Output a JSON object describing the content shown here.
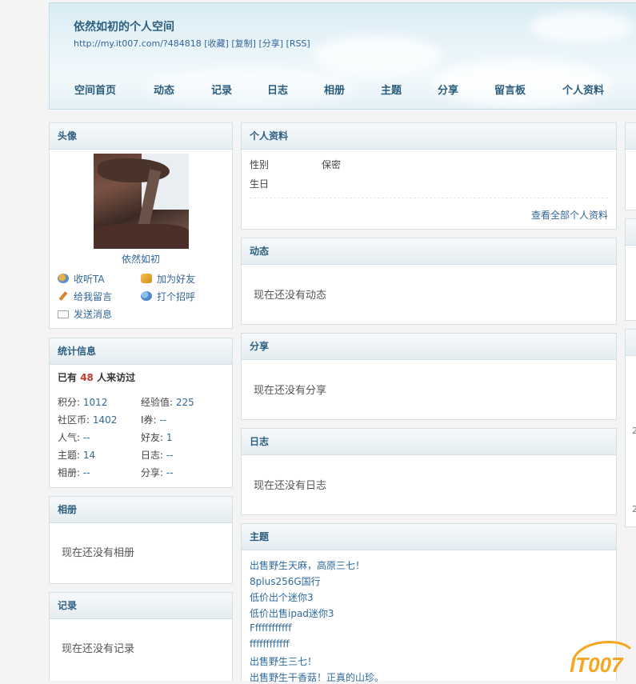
{
  "header": {
    "title": "依然如初的个人空间",
    "url": "http://my.it007.com/?484818",
    "links": [
      "[收藏]",
      "[复制]",
      "[分享]",
      "[RSS]"
    ],
    "nav": [
      "空间首页",
      "动态",
      "记录",
      "日志",
      "相册",
      "主题",
      "分享",
      "留言板",
      "个人资料"
    ]
  },
  "avatar_box": {
    "title": "头像",
    "name": "依然如初",
    "actions": {
      "follow": "收听TA",
      "add_friend": "加为好友",
      "message_board": "给我留言",
      "greet": "打个招呼",
      "send_message": "发送消息"
    }
  },
  "stats_box": {
    "title": "统计信息",
    "visits_prefix": "已有",
    "visits_count": "48",
    "visits_suffix": "人来访过",
    "rows": [
      {
        "label": "积分:",
        "value": "1012",
        "label2": "经验值:",
        "value2": "225"
      },
      {
        "label": "社区币:",
        "value": "1402",
        "label2": "I券:",
        "value2": "--"
      },
      {
        "label": "人气:",
        "value": "--",
        "label2": "好友:",
        "value2": "1"
      },
      {
        "label": "主题:",
        "value": "14",
        "label2": "日志:",
        "value2": "--"
      },
      {
        "label": "相册:",
        "value": "--",
        "label2": "分享:",
        "value2": "--"
      }
    ]
  },
  "album_box": {
    "title": "相册",
    "empty": "现在还没有相册"
  },
  "record_box": {
    "title": "记录",
    "empty": "现在还没有记录"
  },
  "profile_box": {
    "title": "个人资料",
    "gender_label": "性别",
    "gender_value": "保密",
    "birthday_label": "生日",
    "view_all": "查看全部个人资料"
  },
  "feed_box": {
    "title": "动态",
    "empty": "现在还没有动态"
  },
  "share_box": {
    "title": "分享",
    "empty": "现在还没有分享"
  },
  "blog_box": {
    "title": "日志",
    "empty": "现在还没有日志"
  },
  "thread_box": {
    "title": "主题",
    "items": [
      "出售野生天麻，高原三七！",
      "8plus256G国行",
      "低价出个迷你3",
      "低价出售ipad迷你3",
      "Ffffffffffff",
      "ffffffffffff",
      "出售野生三七！",
      "出售野生干香菇！正真的山珍。"
    ]
  },
  "right_partial": {
    "num1": "2",
    "num2": "2"
  },
  "watermark": "IT007",
  "colors": {
    "link": "#336699",
    "accent_count": "#c0392b",
    "nav": "#2a5d7c",
    "logo_orange": "#f5a623"
  }
}
